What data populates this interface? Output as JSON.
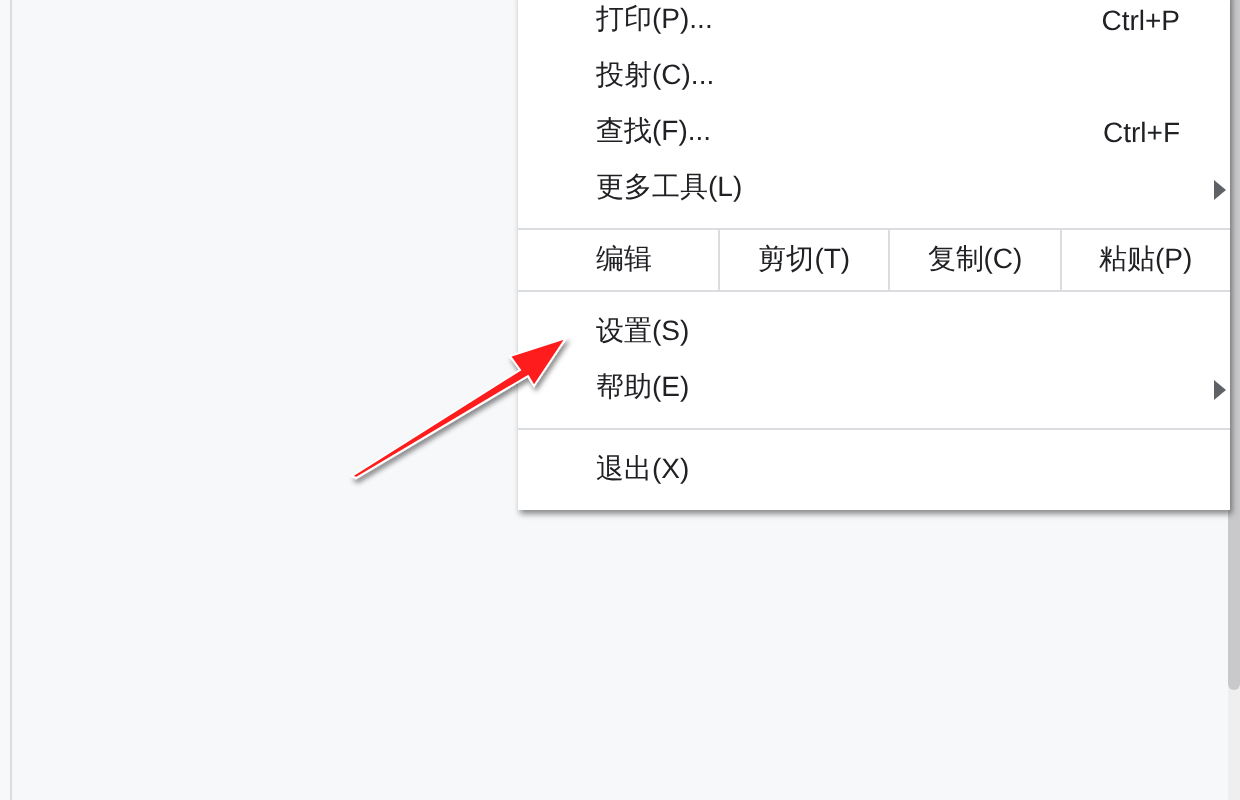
{
  "menu": {
    "items": [
      {
        "kind": "item",
        "label": "打印(P)...",
        "shortcut": "Ctrl+P"
      },
      {
        "kind": "item",
        "label": "投射(C)..."
      },
      {
        "kind": "item",
        "label": "查找(F)...",
        "shortcut": "Ctrl+F"
      },
      {
        "kind": "submenu",
        "label": "更多工具(L)"
      },
      {
        "kind": "separator"
      },
      {
        "kind": "edit",
        "label": "编辑",
        "buttons": [
          "剪切(T)",
          "复制(C)",
          "粘贴(P)"
        ]
      },
      {
        "kind": "separator"
      },
      {
        "kind": "item",
        "label": "设置(S)"
      },
      {
        "kind": "submenu",
        "label": "帮助(E)"
      },
      {
        "kind": "separator"
      },
      {
        "kind": "item",
        "label": "退出(X)"
      }
    ]
  }
}
